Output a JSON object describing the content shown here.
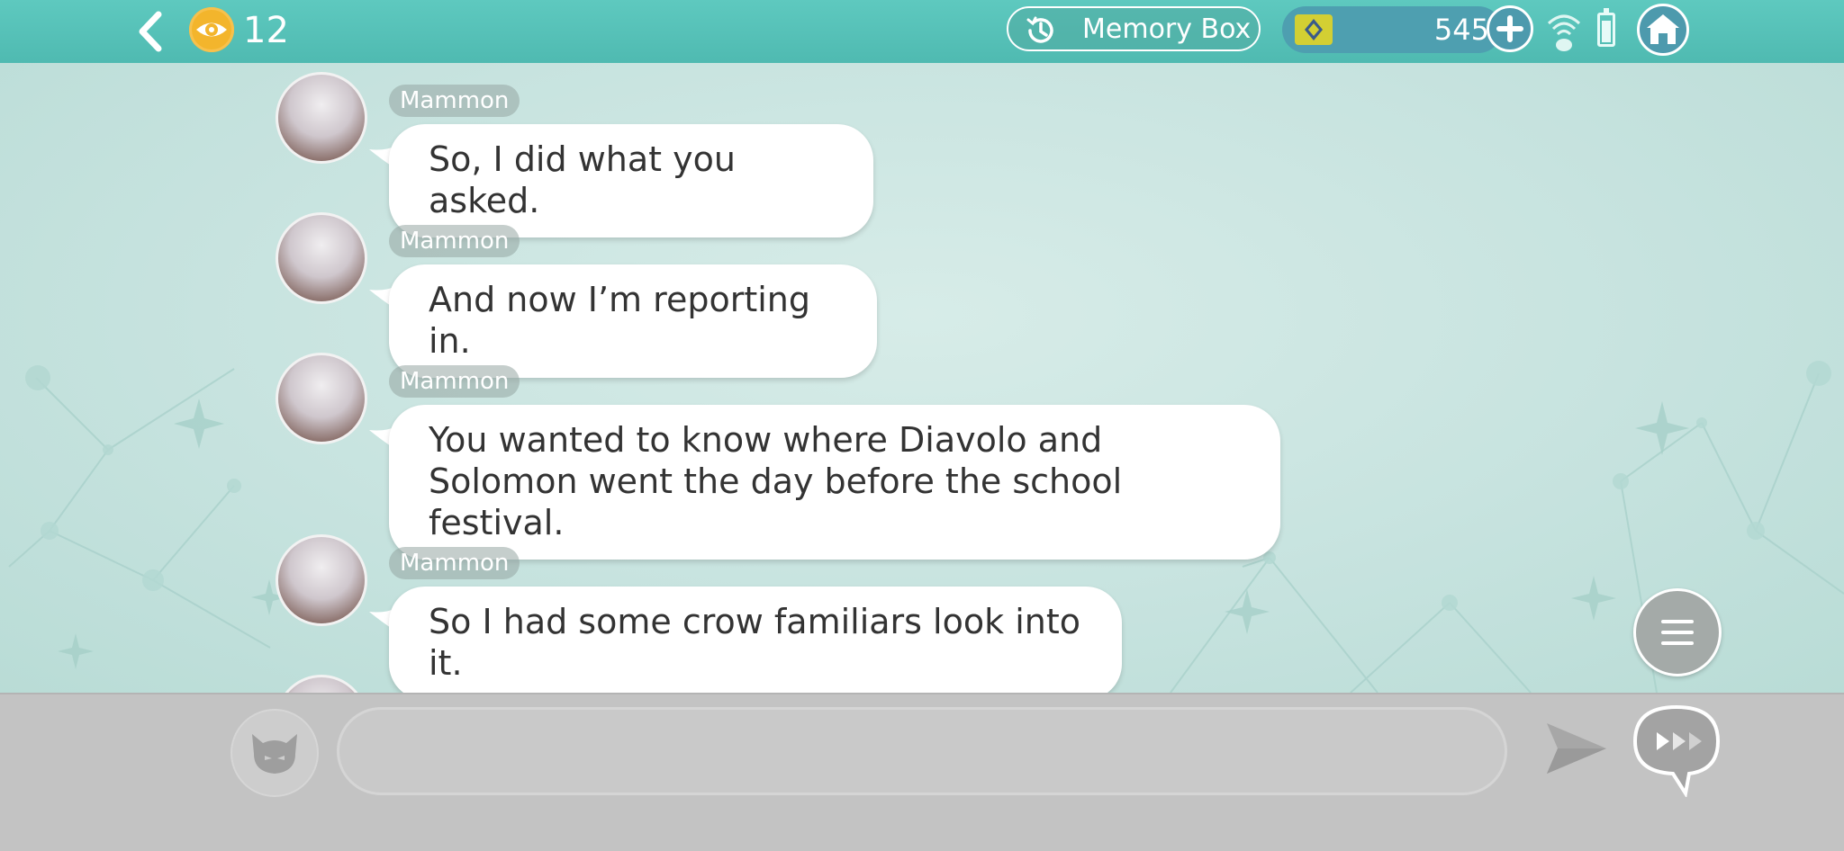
{
  "header": {
    "views_count": "12",
    "memory_box_label": "Memory Box",
    "currency_amount": "545"
  },
  "messages": [
    {
      "speaker": "Mammon",
      "text": "So, I did what you asked."
    },
    {
      "speaker": "Mammon",
      "text": "And now I’m reporting in."
    },
    {
      "speaker": "Mammon",
      "text": "You wanted to know where Diavolo and Solomon went the day before the school festival."
    },
    {
      "speaker": "Mammon",
      "text": "So I had some crow familiars look into it."
    }
  ],
  "input": {
    "value": "",
    "placeholder": ""
  },
  "icons": {
    "back": "back-chevron-icon",
    "eye": "eye-icon",
    "memory": "history-clock-icon",
    "gem": "gem-icon",
    "plus": "plus-icon",
    "wifi": "wifi-signal-icon",
    "battery": "battery-icon",
    "home": "home-icon",
    "menu": "menu-icon",
    "stamp": "devil-face-icon",
    "send": "send-icon",
    "auto": "auto-advance-icon"
  },
  "colors": {
    "header_teal": "#5ec9bf",
    "eye_badge": "#f3b52c",
    "currency_bg": "#4e9fb0",
    "gem": "#d3cf33",
    "input_bar": "#c3c3c3",
    "bubble": "#ffffff"
  }
}
